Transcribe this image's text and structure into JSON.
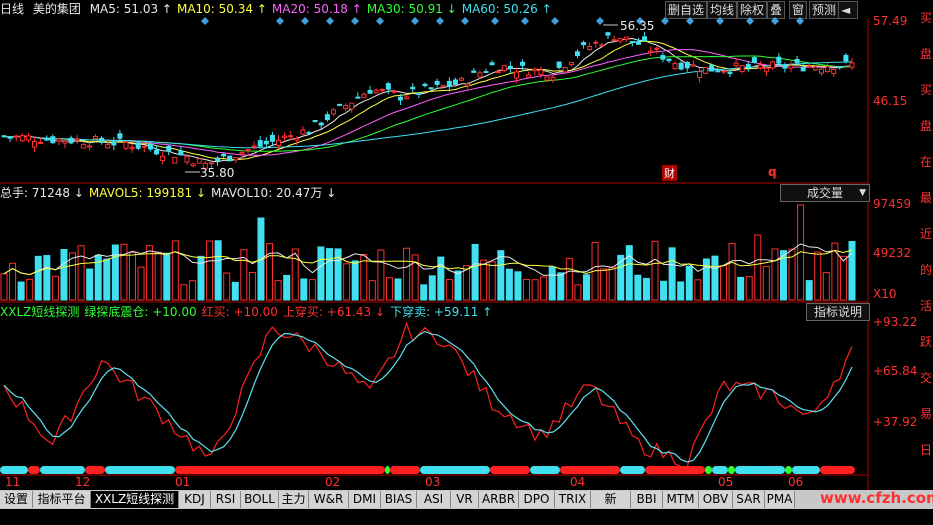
{
  "header": {
    "period": "日线",
    "stock_name": "美的集团",
    "ma": [
      {
        "label": "MA5:",
        "value": "51.03",
        "arrow": "↑",
        "color": "#e8e8e8"
      },
      {
        "label": "MA10:",
        "value": "50.34",
        "arrow": "↑",
        "color": "#ffff40"
      },
      {
        "label": "MA20:",
        "value": "50.18",
        "arrow": "↑",
        "color": "#ff60ff"
      },
      {
        "label": "MA30:",
        "value": "50.91",
        "arrow": "↓",
        "color": "#30ff30"
      },
      {
        "label": "MA60:",
        "value": "50.26",
        "arrow": "↑",
        "color": "#40e0f0"
      }
    ]
  },
  "toolbar": {
    "buttons": [
      "删自选",
      "均线",
      "除权",
      "叠",
      "窗",
      "预测"
    ],
    "arrow_button": "◄",
    "corner": "R"
  },
  "price_panel": {
    "y_labels": [
      "57.49",
      "46.15"
    ],
    "high_label": "56.35",
    "low_label": "35.80",
    "markers": [
      "财",
      "q"
    ]
  },
  "volume_panel": {
    "legend": [
      {
        "label": "总手:",
        "value": "71248",
        "arrow": "↓"
      },
      {
        "label": "MAVOL5:",
        "value": "199181",
        "arrow": "↓"
      },
      {
        "label": "MAVOL10:",
        "value": "20.47万",
        "arrow": "↓"
      }
    ],
    "dropdown": "成交量",
    "y_labels": [
      "97459",
      "49232",
      "X10"
    ]
  },
  "indicator_panel": {
    "legend": [
      {
        "text": "XXLZ短线探测",
        "color": "#30ff30"
      },
      {
        "text": "绿探底震仓: +10.00",
        "color": "#30ff30"
      },
      {
        "text": "红买: +10.00",
        "color": "#ff3030"
      },
      {
        "text": "上穿买: +61.43",
        "arrow": "↓",
        "color": "#ff3030"
      },
      {
        "text": "下穿卖: +59.11",
        "arrow": "↑",
        "color": "#40e0f0"
      }
    ],
    "explain_button": "指标说明",
    "y_labels": [
      "+93.22",
      "+65.84",
      "+37.92"
    ]
  },
  "month_labels": [
    "11",
    "12",
    "01",
    "02",
    "03",
    "04",
    "05",
    "06"
  ],
  "tabs": [
    "设置",
    "指标平台",
    "XXLZ短线探测",
    "KDJ",
    "RSI",
    "BOLL",
    "主力",
    "W&R",
    "DMI",
    "BIAS",
    "ASI",
    "VR",
    "ARBR",
    "DPO",
    "TRIX",
    "新DMA",
    "BBI",
    "MTM",
    "OBV",
    "SAR",
    "PMA"
  ],
  "active_tab": "XXLZ短线探测",
  "watermark": "www.cfzh.com",
  "side_text": [
    "买",
    "盘",
    "买",
    "盘",
    "在",
    "最",
    "近",
    "的",
    "活",
    "跃",
    "交",
    "易",
    "日"
  ],
  "chart_data": {
    "type": "candlestick",
    "price_range": [
      35.8,
      57.49
    ],
    "ma_values": {
      "MA5": 51.03,
      "MA10": 50.34,
      "MA20": 50.18,
      "MA30": 50.91,
      "MA60": 50.26
    },
    "volume_range": [
      0,
      97459
    ],
    "indicator_range": [
      10,
      93.22
    ]
  }
}
